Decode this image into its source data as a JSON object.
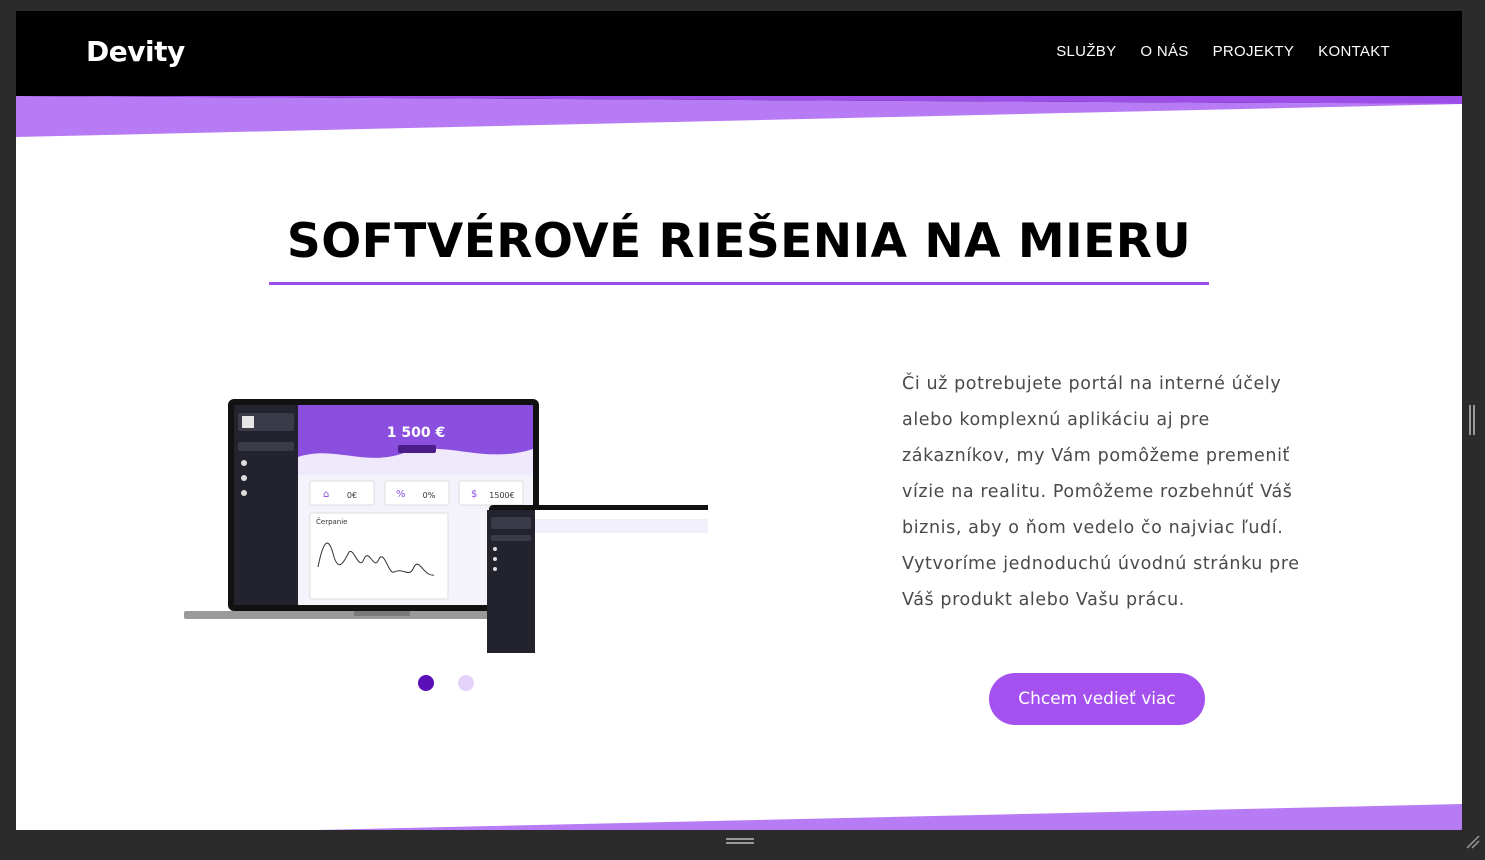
{
  "nav": {
    "logo": "Devity",
    "links": [
      "SLUŽBY",
      "O NÁS",
      "PROJEKTY",
      "KONTAKT"
    ]
  },
  "hero": {
    "title": "SOFTVÉROVÉ RIEŠENIA NA MIERU",
    "description": "Či už potrebujete portál na interné účely alebo komplexnú aplikáciu aj pre zákazníkov, my Vám pomôžeme premeniť vízie na realitu. Pomôžeme rozbehnúť Váš biznis, aby o ňom vedelo čo najviac ľudí. Vytvoríme jednoduchú úvodnú stránku pre Váš produkt alebo Vašu prácu.",
    "cta_label": "Chcem vedieť viac"
  },
  "mockup": {
    "balance": "1 500 €",
    "stat_1": "0€",
    "stat_2": "0%",
    "stat_3": "1500€",
    "chart_title": "Čerpanie"
  },
  "carousel": {
    "active_index": 0,
    "count": 2
  },
  "colors": {
    "accent": "#a451f0",
    "wedge": "#b77cf5",
    "dot_active": "#5a0fb8",
    "dot_inactive": "#e4d2fb"
  },
  "icons": [
    "scroll-handle-icon",
    "resize-bar-icon",
    "resize-grip-icon"
  ]
}
